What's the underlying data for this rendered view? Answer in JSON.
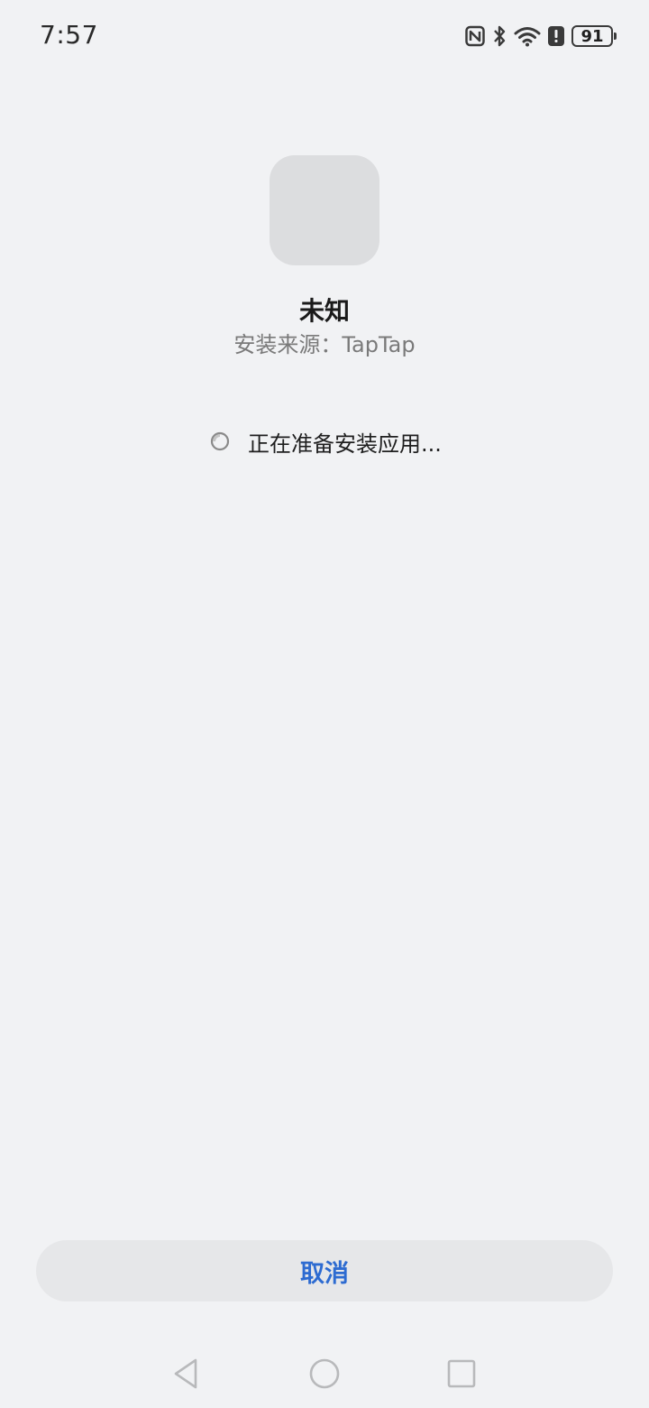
{
  "status_bar": {
    "time": "7:57",
    "battery_level": "91",
    "icons": [
      "nfc-icon",
      "bluetooth-icon",
      "wifi-icon",
      "alert-icon",
      "battery-icon"
    ]
  },
  "app": {
    "name": "未知",
    "install_source": "安装来源：TapTap",
    "icon": "app-placeholder-icon"
  },
  "progress": {
    "text": "正在准备安装应用...",
    "icon": "loading-spinner-icon"
  },
  "actions": {
    "cancel_label": "取消",
    "accent_color": "#2d6bd1"
  },
  "nav_bar": {
    "icons": [
      "back-icon",
      "home-icon",
      "recents-icon"
    ]
  }
}
